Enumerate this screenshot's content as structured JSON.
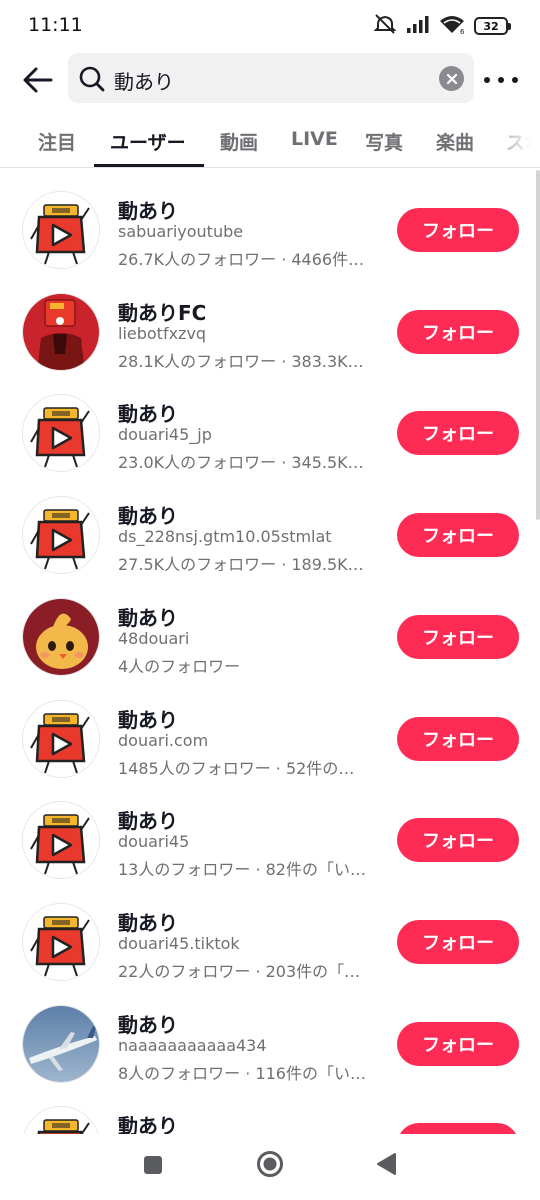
{
  "status_bar": {
    "time": "11:11",
    "battery": "32",
    "icons": [
      "mute-icon",
      "signal-icon",
      "wifi-icon",
      "battery-icon"
    ]
  },
  "search": {
    "query": "動あり",
    "icons": [
      "back-arrow-icon",
      "search-icon",
      "clear-icon",
      "more-icon"
    ]
  },
  "tabs": [
    {
      "label": "注目",
      "active": false
    },
    {
      "label": "ユーザー",
      "active": true
    },
    {
      "label": "動画",
      "active": false
    },
    {
      "label": "LIVE",
      "active": false
    },
    {
      "label": "写真",
      "active": false
    },
    {
      "label": "楽曲",
      "active": false
    },
    {
      "label": "スポ",
      "active": false
    }
  ],
  "users": [
    {
      "name": "動あり",
      "id": "sabuariyoutube",
      "stats": "26.7K人のフォロワー · 4466件…",
      "follow": "フォロー",
      "avatar": "doari-logo"
    },
    {
      "name": "動ありFC",
      "id": "liebotfxzvq",
      "stats": "28.1K人のフォロワー · 383.3K…",
      "follow": "フォロー",
      "avatar": "red-character"
    },
    {
      "name": "動あり",
      "id": "douari45_jp",
      "stats": "23.0K人のフォロワー · 345.5K…",
      "follow": "フォロー",
      "avatar": "doari-logo"
    },
    {
      "name": "動あり",
      "id": "ds_228nsj.gtm10.05stmlat",
      "stats": "27.5K人のフォロワー · 189.5K…",
      "follow": "フォロー",
      "avatar": "doari-logo"
    },
    {
      "name": "動あり",
      "id": "48douari",
      "stats": "4人のフォロワー",
      "follow": "フォロー",
      "avatar": "yellow-character"
    },
    {
      "name": "動あり",
      "id": "douari.com",
      "stats": "1485人のフォロワー · 52件の…",
      "follow": "フォロー",
      "avatar": "doari-logo"
    },
    {
      "name": "動あり",
      "id": "douari45",
      "stats": "13人のフォロワー · 82件の「い…",
      "follow": "フォロー",
      "avatar": "doari-logo"
    },
    {
      "name": "動あり",
      "id": "douari45.tiktok",
      "stats": "22人のフォロワー · 203件の「…",
      "follow": "フォロー",
      "avatar": "doari-logo"
    },
    {
      "name": "動あり",
      "id": "naaaaaaaaaaa434",
      "stats": "8人のフォロワー · 116件の「い…",
      "follow": "フォロー",
      "avatar": "airplane-photo"
    },
    {
      "name": "動あり",
      "id": "",
      "stats": "",
      "follow": "フォロー",
      "avatar": "doari-logo"
    }
  ],
  "colors": {
    "accent": "#fe2c55",
    "text_primary": "#161823",
    "text_secondary": "#6f7073",
    "search_bg": "#f1f1f2",
    "logo_red": "#e8392c",
    "logo_yellow": "#f5b62b"
  },
  "nav": {
    "icons": [
      "recents-square-icon",
      "home-circle-icon",
      "back-triangle-icon"
    ]
  }
}
